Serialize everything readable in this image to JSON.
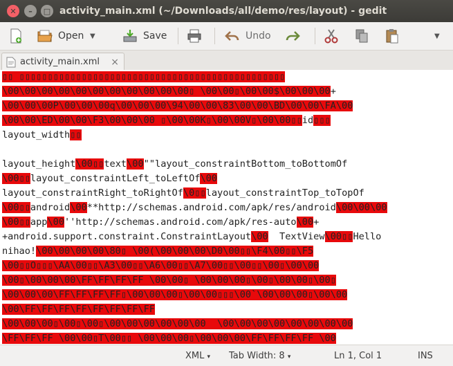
{
  "window": {
    "title": "activity_main.xml (~/Downloads/all/demo/res/layout) - gedit"
  },
  "toolbar": {
    "open_label": "Open",
    "save_label": "Save",
    "undo_label": "Undo"
  },
  "tab": {
    "label": "activity_main.xml",
    "close": "×"
  },
  "editor": {
    "lines": [
      {
        "segments": [
          [
            "r",
            "▯▯ ▯▯▯▯▯▯▯▯▯▯▯▯▯▯▯▯▯▯▯▯▯▯▯▯▯▯▯▯▯▯▯▯▯▯▯▯▯▯▯▯▯▯▯▯▯▯▯"
          ]
        ]
      },
      {
        "segments": [
          [
            "r",
            "\\00\\00\\00\\00\\00\\00\\00\\00\\00\\00\\00▯ \\00\\00▯\\00\\00$\\00\\00\\00"
          ],
          [
            "t",
            "+"
          ]
        ]
      },
      {
        "segments": [
          [
            "r",
            "\\00\\00\\00P\\00\\00\\00q\\00\\00\\00\\94\\00\\00\\83\\00\\00\\BD\\00\\00\\FA\\00"
          ]
        ]
      },
      {
        "segments": [
          [
            "r",
            "\\00\\00\\ED\\00\\00\\F3\\00\\00\\00 ▯\\00\\00K▯\\00\\00V▯\\00\\00▯▯"
          ],
          [
            "t",
            "id"
          ],
          [
            "r",
            "▯▯▯"
          ]
        ]
      },
      {
        "segments": [
          [
            "t",
            "layout_width"
          ],
          [
            "r",
            "▯▯"
          ]
        ]
      },
      {
        "segments": [
          [
            "t",
            ""
          ]
        ]
      },
      {
        "segments": [
          [
            "t",
            "layout_height"
          ],
          [
            "r",
            "\\00▯▯"
          ],
          [
            "t",
            "text"
          ],
          [
            "r",
            "\\00"
          ],
          [
            "t",
            "\"\"layout_constraintBottom_toBottomOf"
          ]
        ]
      },
      {
        "segments": [
          [
            "r",
            "\\00▯▯"
          ],
          [
            "t",
            "layout_constraintLeft_toLeftOf"
          ],
          [
            "r",
            "\\00"
          ]
        ]
      },
      {
        "segments": [
          [
            "t",
            "layout_constraintRight_toRightOf"
          ],
          [
            "r",
            "\\0▯▯"
          ],
          [
            "t",
            "layout_constraintTop_toTopOf"
          ]
        ]
      },
      {
        "segments": [
          [
            "r",
            "\\00▯▯"
          ],
          [
            "t",
            "android"
          ],
          [
            "r",
            "\\00"
          ],
          [
            "t",
            "**http://schemas.android.com/apk/res/android"
          ],
          [
            "r",
            "\\00\\00\\00"
          ]
        ]
      },
      {
        "segments": [
          [
            "r",
            "\\00▯▯"
          ],
          [
            "t",
            "app"
          ],
          [
            "r",
            "\\00"
          ],
          [
            "t",
            "''http://schemas.android.com/apk/res-auto"
          ],
          [
            "r",
            "\\00"
          ],
          [
            "t",
            "+"
          ]
        ]
      },
      {
        "segments": [
          [
            "t",
            "+android.support.constraint.ConstraintLayout"
          ],
          [
            "r",
            "\\00"
          ],
          [
            "t",
            "  TextView"
          ],
          [
            "r",
            "\\00▯▯"
          ],
          [
            "t",
            "Hello"
          ]
        ]
      },
      {
        "segments": [
          [
            "t",
            "nihao!"
          ],
          [
            "r",
            "\\00\\00\\00\\00\\80▯ \\00(\\00\\00\\00\\D0\\00▯▯\\F4\\00▯▯\\F5"
          ]
        ]
      },
      {
        "segments": [
          [
            "r",
            "\\00▯▯O▯▯▯\\AA\\00▯▯\\A3\\00▯▯\\A6\\00▯▯\\A7\\00▯▯\\00▯▯\\00▯\\00\\00"
          ]
        ]
      },
      {
        "segments": [
          [
            "r",
            "\\00▯\\00\\00\\00\\FF\\FF\\FF\\FF \\00\\00▯ \\00\\00\\00▯\\00▯\\00\\00▯\\00▯"
          ]
        ]
      },
      {
        "segments": [
          [
            "r",
            "\\00\\00\\00\\FF\\FF\\FF\\FF▯\\00\\00\\00▯\\00\\00▯▯▯\\00`\\00\\00\\00▯\\00\\00"
          ]
        ]
      },
      {
        "segments": [
          [
            "r",
            "\\00\\FF\\FF\\FF\\FF\\FF\\FF\\FF\\FF"
          ]
        ]
      },
      {
        "segments": [
          [
            "r",
            "\\00\\00\\00▯\\00▯\\00▯\\00\\00\\00\\00\\00\\00  \\00\\00\\00\\00\\00\\00\\00\\00"
          ]
        ]
      },
      {
        "segments": [
          [
            "r",
            "\\FF\\FF\\FF \\00\\00▯T\\00▯▯ \\00\\00\\00▯\\00\\00\\00\\FF\\FF\\FF\\FF \\00"
          ]
        ]
      },
      {
        "segments": [
          [
            "r",
            "\\00▯\\FF\\FF\\FF  \\00\\00\\00▯\\00\\00\\00\\FF\\FF\\FF \\00\\00▯\\FF\\FF"
          ]
        ]
      }
    ]
  },
  "statusbar": {
    "language": "XML",
    "tab_width": "Tab Width: 8",
    "position": "Ln 1, Col 1",
    "mode": "INS"
  }
}
